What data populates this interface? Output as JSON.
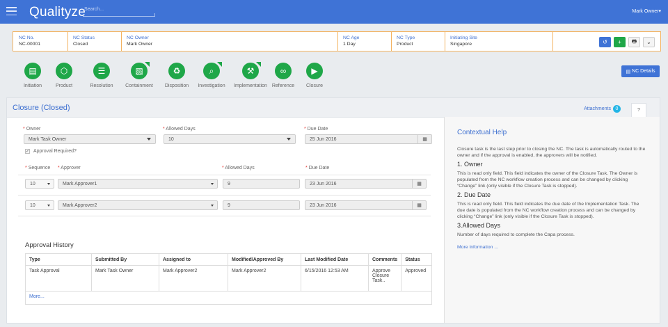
{
  "header": {
    "logo": "Qualityze",
    "search_placeholder": "Search...",
    "user": "Mark Owner▾"
  },
  "nc_info": [
    {
      "label": "NC No.",
      "value": "NC-00001"
    },
    {
      "label": "NC Status",
      "value": "Closed"
    },
    {
      "label": "NC Owner",
      "value": "Mark Owner"
    },
    {
      "label": "NC Age",
      "value": "1 Day"
    },
    {
      "label": "NC Type",
      "value": "Product"
    },
    {
      "label": "Initiating Site",
      "value": "Singapore"
    }
  ],
  "toolbar": {
    "history_icon": "history-icon",
    "add_icon": "plus-icon",
    "print_icon": "print-icon",
    "more_icon": "chevron-down-icon"
  },
  "steps": [
    {
      "label": "Initiation",
      "icon": "document-icon"
    },
    {
      "label": "Product",
      "icon": "cube-icon"
    },
    {
      "label": "Resolution",
      "icon": "list-icon"
    },
    {
      "label": "Containment",
      "icon": "boxes-icon"
    },
    {
      "label": "Disposition",
      "icon": "recycle-icon"
    },
    {
      "label": "Investigation",
      "icon": "magnifier-icon"
    },
    {
      "label": "Implementation",
      "icon": "tools-icon"
    },
    {
      "label": "Reference",
      "icon": "link-icon"
    },
    {
      "label": "Closure",
      "icon": "exit-icon"
    }
  ],
  "nc_details_button": "NC Details",
  "panel": {
    "title": "Closure (Closed)",
    "attachments_label": "Attachments",
    "attachments_count": "0",
    "help_tab": "?"
  },
  "form": {
    "owner_label": "Owner",
    "owner_value": "Mark Task Owner",
    "allowed_days_label": "Allowed Days",
    "allowed_days_value": "10",
    "due_date_label": "Due Date",
    "due_date_value": "25 Jun 2016",
    "approval_required_label": "Approval Required?",
    "sequence_label": "Sequence",
    "approver_label": "Approver",
    "approver_allowed_days_label": "Allowed Days",
    "approver_due_date_label": "Due Date",
    "approvers": [
      {
        "sequence": "10",
        "approver": "Mark Approver1",
        "allowed_days": "9",
        "due_date": "23 Jun 2016"
      },
      {
        "sequence": "10",
        "approver": "Mark Approver2",
        "allowed_days": "9",
        "due_date": "23 Jun 2016"
      }
    ]
  },
  "history": {
    "title": "Approval History",
    "columns": [
      "Type",
      "Submitted By",
      "Assigned to",
      "Modified/Approved By",
      "Last Modified Date",
      "Comments",
      "Status"
    ],
    "rows": [
      [
        "Task Approval",
        "Mark Task Owner",
        "Mark Approver2",
        "Mark Approver2",
        "6/15/2016 12:53 AM",
        "Approve Closure Task..",
        "Approved"
      ]
    ],
    "more": "More..."
  },
  "help": {
    "title": "Contextual Help",
    "intro": "Closure task is the last step prior to closing the NC. The task is automatically routed to the owner and if the approval is enabled, the approvers will be notified.",
    "sections": [
      {
        "heading": "1. Owner",
        "text": "This is read only field. This field indicates the owner of the Closure Task. The Owner is populated from the NC workflow creation process and can be changed by clicking “Change” link (only visible if the Closure Task is stopped)."
      },
      {
        "heading": "2. Due Date",
        "text": "This is read only field. This field indicates the due date of the Implementation Task. The due date is populated from the NC workflow creation process and can be changed by clicking “Change” link (only visible if the Closure Task is stopped)."
      },
      {
        "heading": "3.Allowed Days",
        "text": "Number of days required to complete the Capa process."
      }
    ],
    "more": "More Information ..."
  },
  "colors": {
    "topbar": "#3f73d6",
    "step_green": "#1fa748",
    "accent_blue": "#3d6fd0",
    "info_border": "#f3b25f",
    "badge": "#22b5e6"
  }
}
